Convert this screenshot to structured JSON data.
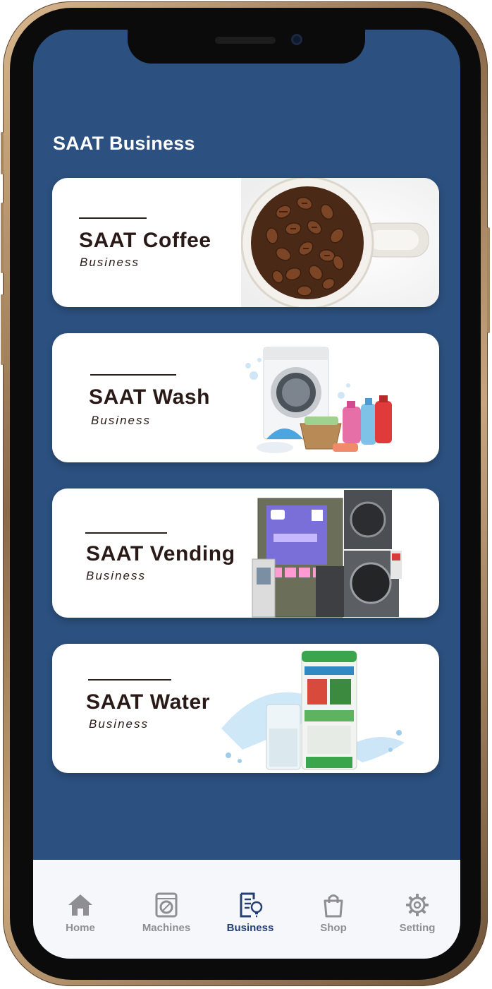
{
  "screen": {
    "title": "SAAT Business"
  },
  "cards": [
    {
      "name": "SAAT Coffee",
      "sub": "Business",
      "image": "coffee-beans-cup"
    },
    {
      "name": "SAAT Wash",
      "sub": "Business",
      "image": "washing-machine-detergents"
    },
    {
      "name": "SAAT Vending",
      "sub": "Business",
      "image": "vending-machines"
    },
    {
      "name": "SAAT Water",
      "sub": "Business",
      "image": "water-dispenser-glass"
    }
  ],
  "tabbar": {
    "active": "Business",
    "items": [
      {
        "label": "Home",
        "icon": "home-icon"
      },
      {
        "label": "Machines",
        "icon": "washer-icon"
      },
      {
        "label": "Business",
        "icon": "business-document-icon"
      },
      {
        "label": "Shop",
        "icon": "shopping-bag-icon"
      },
      {
        "label": "Setting",
        "icon": "gear-icon"
      }
    ]
  },
  "colors": {
    "background": "#2c507f",
    "card": "#ffffff",
    "title_text": "#ffffff",
    "card_text": "#2a1a17",
    "tab_active": "#233f73",
    "tab_inactive": "#8e8e93",
    "phone_frame": "#c8a57c"
  }
}
